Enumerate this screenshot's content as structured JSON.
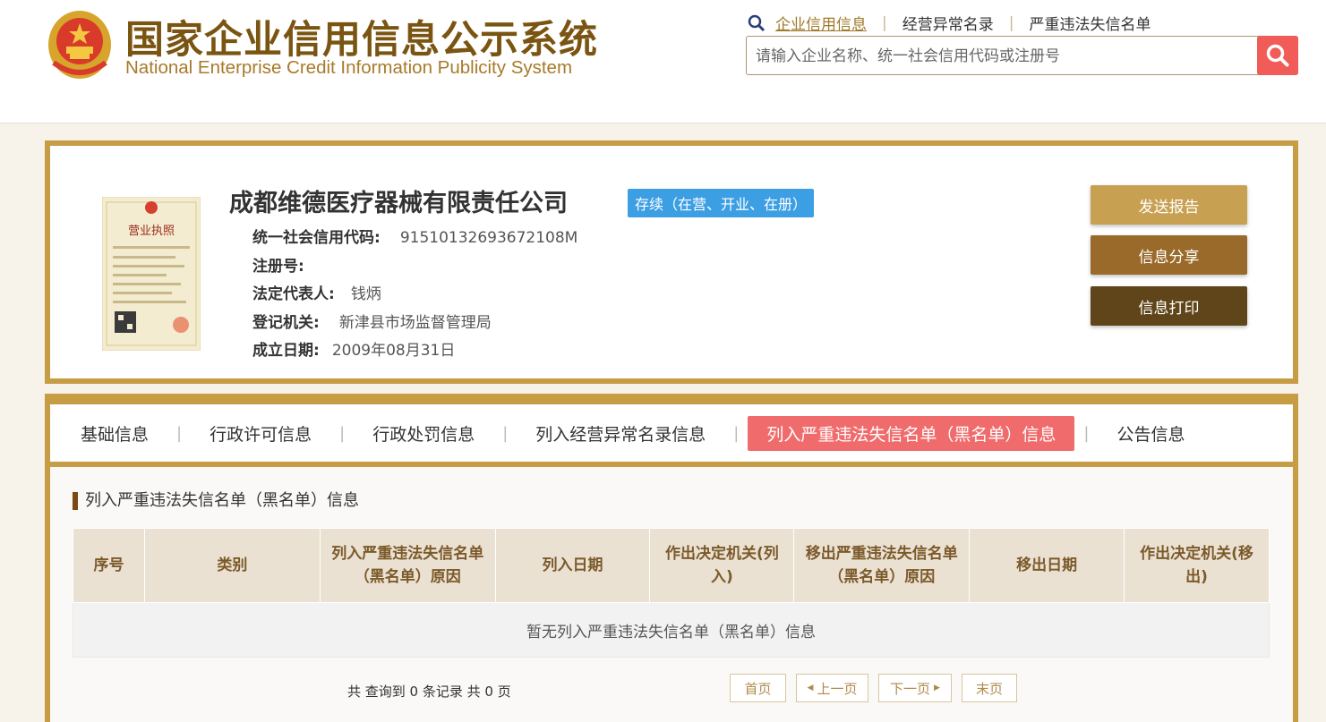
{
  "header": {
    "logo_cn": "国家企业信用信息公示系统",
    "logo_en": "National Enterprise Credit Information Publicity System",
    "links": [
      "企业信用信息",
      "经营异常名录",
      "严重违法失信名单"
    ],
    "separator": "|",
    "search_placeholder": "请输入企业名称、统一社会信用代码或注册号"
  },
  "company": {
    "name": "成都维德医疗器械有限责任公司",
    "status": "存续（在营、开业、在册）",
    "license_title": "营业执照",
    "fields": [
      {
        "label": "统一社会信用代码:",
        "value": "91510132693672108M"
      },
      {
        "label": "注册号:",
        "value": ""
      },
      {
        "label": "法定代表人:",
        "value": "钱炳"
      },
      {
        "label": "登记机关:",
        "value": "新津县市场监督管理局"
      },
      {
        "label": "成立日期:",
        "value": "2009年08月31日"
      }
    ],
    "actions": [
      "发送报告",
      "信息分享",
      "信息打印"
    ]
  },
  "tabs": [
    "基础信息",
    "行政许可信息",
    "行政处罚信息",
    "列入经营异常名录信息",
    "列入严重违法失信名单（黑名单）信息",
    "公告信息"
  ],
  "section": {
    "title": "列入严重违法失信名单（黑名单）信息",
    "columns": [
      "序号",
      "类别",
      "列入严重违法失信名单（黑名单）原因",
      "列入日期",
      "作出决定机关(列入)",
      "移出严重违法失信名单（黑名单）原因",
      "移出日期",
      "作出决定机关(移出)"
    ],
    "empty_text": "暂无列入严重违法失信名单（黑名单）信息"
  },
  "pager": {
    "info": "共 查询到 0 条记录 共 0 页",
    "first": "首页",
    "prev": "上一页",
    "next": "下一页",
    "last": "末页"
  },
  "colors": {
    "brand_gold": "#c69d45",
    "btn_send": "#c8a052",
    "btn_share": "#9a6a2a",
    "btn_print": "#5f4519",
    "active_tab": "#f06b6b",
    "status_badge": "#3d9fe3",
    "search_button": "#f15b58"
  }
}
